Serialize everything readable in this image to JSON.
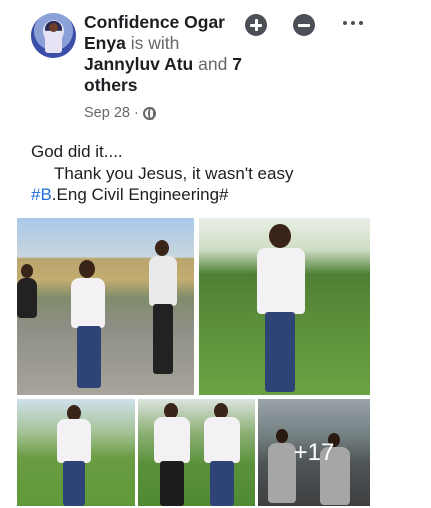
{
  "post": {
    "author": "Confidence Ogar Enya",
    "with_text": "is with",
    "tagged": "Jannyluv Atu",
    "and_text": "and",
    "others": "7 others",
    "date": "Sep 28",
    "separator": "·",
    "privacy_icon": "globe-icon",
    "text_line1": "God did it....",
    "text_line2": "Thank you Jesus, it wasn't easy",
    "hashtag": "#B",
    "text_line3_rest": ".Eng Civil Engineering#"
  },
  "actions": {
    "add_icon": "plus-circle-icon",
    "remove_icon": "minus-circle-icon",
    "more_icon": "more-dots-icon"
  },
  "photos": {
    "more_count": "+17"
  },
  "colors": {
    "link": "#216fdb",
    "meta_text": "#65676b",
    "icon_dark": "#4b4f56"
  }
}
